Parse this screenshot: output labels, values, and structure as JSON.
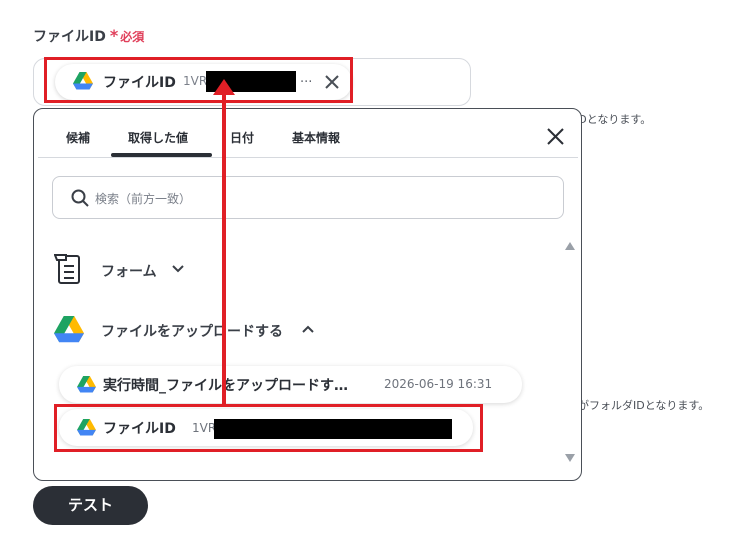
{
  "field": {
    "label": "ファイルID",
    "required_star": "*",
    "required_text": "必須",
    "chip_label": "ファイルID",
    "chip_value_prefix": "1VR",
    "chip_ellipsis": "..."
  },
  "hints": {
    "hint1": "IDとなります。",
    "hint2": "がフォルダIDとなります。"
  },
  "popup": {
    "tabs": [
      {
        "label": "候補"
      },
      {
        "label": "取得した値"
      },
      {
        "label": "日付"
      },
      {
        "label": "基本情報"
      }
    ],
    "active_tab": "取得した値",
    "search_placeholder": "検索（前方一致）",
    "groups": [
      {
        "label": "フォーム",
        "expanded": false
      },
      {
        "label": "ファイルをアップロードする",
        "expanded": true
      }
    ],
    "items": [
      {
        "title": "実行時間_ファイルをアップロードす…",
        "meta": "2026-06-19 16:31"
      },
      {
        "title": "ファイルID",
        "meta": "1VR"
      }
    ]
  },
  "test_button": {
    "label": "テスト"
  },
  "colors": {
    "required": "#e0405b",
    "highlight": "#e01f26",
    "button_bg": "#2b2f36",
    "drive_green": "#1ea362",
    "drive_yellow": "#ffba00",
    "drive_blue": "#4285f4"
  }
}
